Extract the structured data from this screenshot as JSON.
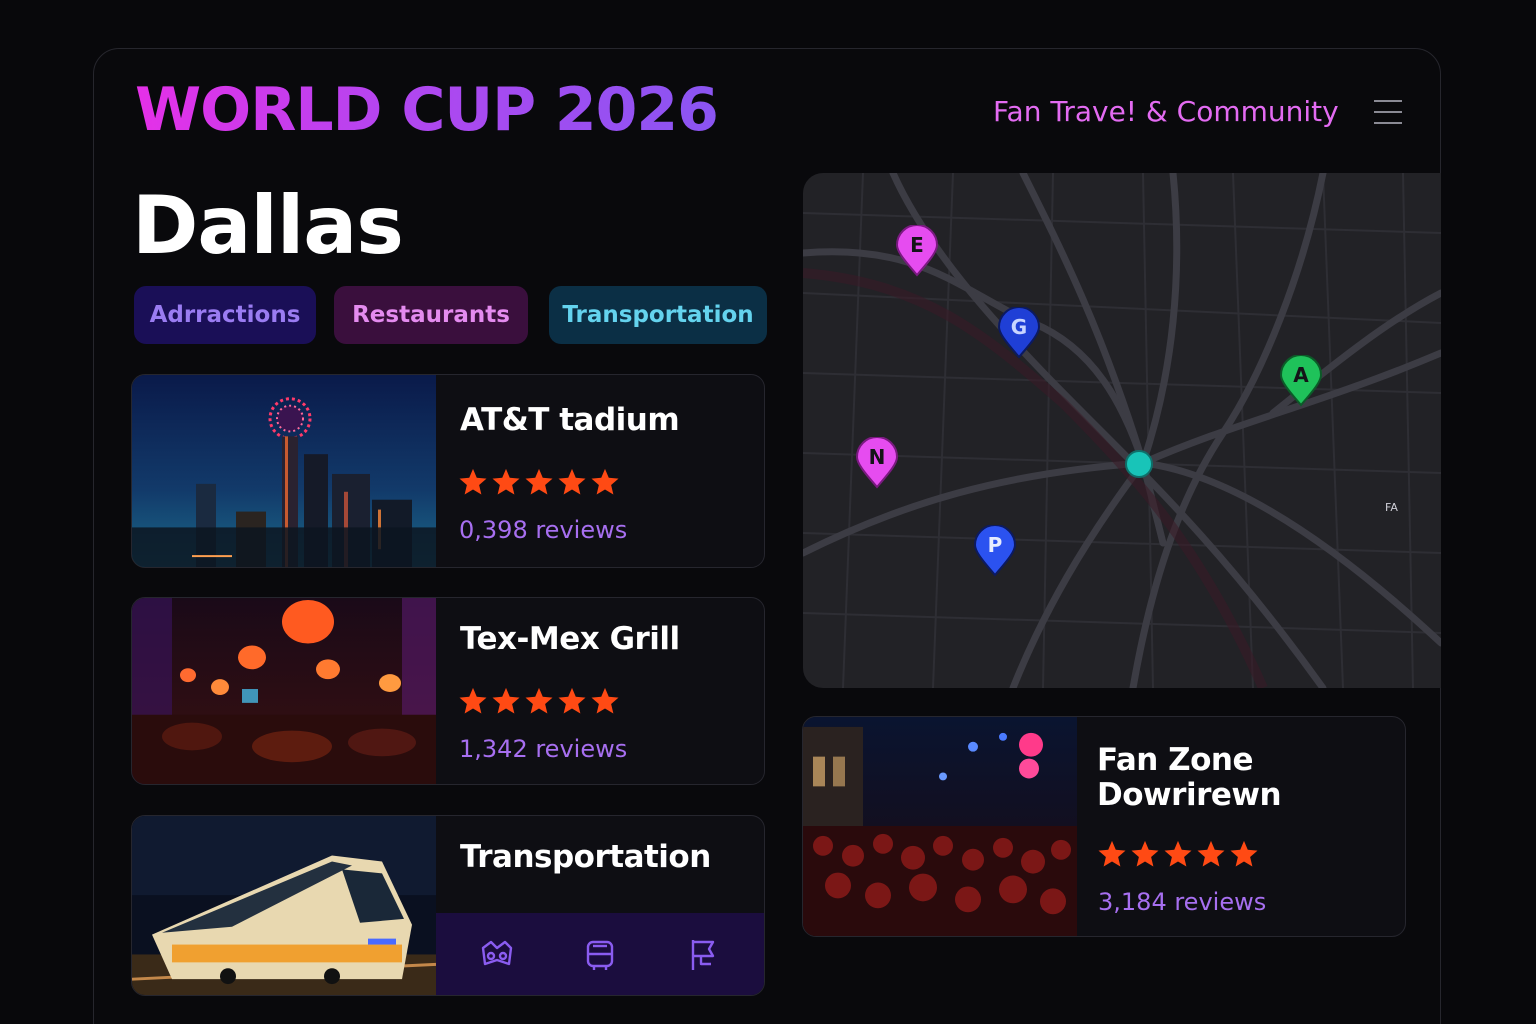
{
  "header": {
    "brand": "WORLD CUP 2026",
    "subtitle": "Fan Trave! & Community",
    "menu_icon": "hamburger-menu-icon"
  },
  "city": "Dallas",
  "tabs": [
    {
      "label": "Adrractions",
      "color": "#9a7cf2"
    },
    {
      "label": "Restaurants",
      "color": "#e48bef"
    },
    {
      "label": "Transportation",
      "color": "#64d3ee"
    }
  ],
  "cards": [
    {
      "title": "AT&T tadium",
      "rating": 5,
      "reviews": "0,398 reviews",
      "image": "dallas-skyline-night-photo"
    },
    {
      "title": "Tex-Mex Grill",
      "rating": 5,
      "reviews": "1,342 reviews",
      "image": "restaurant-interior-lanterns-photo"
    },
    {
      "title": "Transportation",
      "image": "light-rail-train-photo",
      "actions": [
        "car-share-icon",
        "bus-icon",
        "flag-icon"
      ]
    }
  ],
  "map": {
    "pins": [
      {
        "label": "E",
        "color": "#e64cf0"
      },
      {
        "label": "G",
        "color": "#1f3fd6"
      },
      {
        "label": "A",
        "color": "#1fc25a"
      },
      {
        "label": "N",
        "color": "#e64cf0"
      },
      {
        "label": "P",
        "color": "#2b52f0"
      }
    ],
    "mark": "FA"
  },
  "fan_zone": {
    "title_line1": "Fan Zone",
    "title_line2": "Dowrirewn",
    "rating": 5,
    "reviews": "3,184 reviews",
    "image": "fan-zone-crowd-night-photo"
  },
  "colors": {
    "background": "#08080b",
    "star": "#ff4a14",
    "reviews": "#a76ff0",
    "brand_gradient_start": "#e530e8",
    "brand_gradient_end": "#8a55f2"
  }
}
